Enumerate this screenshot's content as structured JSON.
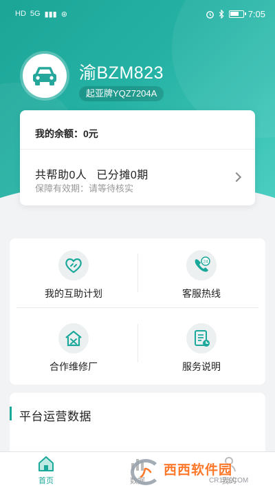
{
  "status_bar": {
    "left_glyphs": [
      "HD",
      "5G",
      "▮▮▮",
      "⊛"
    ],
    "time": "7:05"
  },
  "profile": {
    "avatar_icon": "car-icon",
    "plate": "渝BZM823",
    "car_model": "起亚牌YQZ7204A"
  },
  "balance_card": {
    "balance_label": "我的余额：",
    "balance_value": "0元",
    "helped": "共帮助0人",
    "shared": "已分摊0期",
    "validity": "保障有效期：请等待核实"
  },
  "services": [
    {
      "label": "我的互助计划",
      "icon": "heart-link-icon"
    },
    {
      "label": "客服热线",
      "icon": "phone-24-icon"
    },
    {
      "label": "合作维修厂",
      "icon": "repair-shop-icon"
    },
    {
      "label": "服务说明",
      "icon": "document-icon"
    }
  ],
  "platform": {
    "title": "平台运营数据"
  },
  "bottom_nav": [
    {
      "label": "首页",
      "icon": "home-icon",
      "active": true
    },
    {
      "label": "数据",
      "icon": "data-icon",
      "active": false
    },
    {
      "label": "我的",
      "icon": "profile-icon",
      "active": false
    }
  ],
  "watermark": {
    "main": "西西软件园",
    "sub": "CR173.COM"
  },
  "colors": {
    "brand": "#1aa89a",
    "header_gradient_start": "#1ba597",
    "header_gradient_end": "#4ccfc2"
  }
}
